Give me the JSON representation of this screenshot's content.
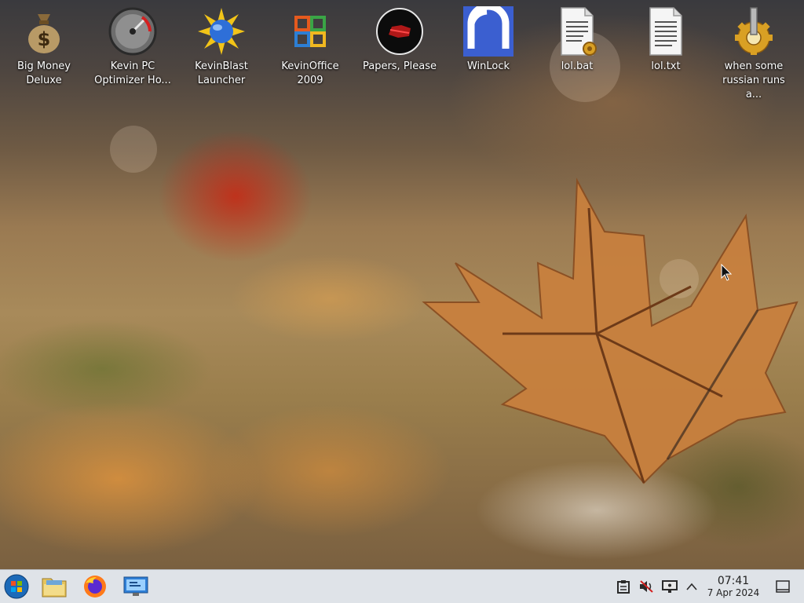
{
  "desktop": {
    "icons": [
      {
        "label_line1": "Big Money",
        "label_line2": "Deluxe",
        "icon": "money-bag-icon"
      },
      {
        "label_line1": "Kevin PC",
        "label_line2": "Optimizer Ho...",
        "icon": "speedometer-icon"
      },
      {
        "label_line1": "KevinBlast",
        "label_line2": "Launcher",
        "icon": "blast-sun-icon"
      },
      {
        "label_line1": "KevinOffice",
        "label_line2": "2009",
        "icon": "office-logo-icon"
      },
      {
        "label_line1": "Papers, Please",
        "label_line2": "",
        "icon": "stamp-seal-icon"
      },
      {
        "label_line1": "WinLock",
        "label_line2": "",
        "icon": "padlock-icon"
      },
      {
        "label_line1": "lol.bat",
        "label_line2": "",
        "icon": "batch-file-icon"
      },
      {
        "label_line1": "lol.txt",
        "label_line2": "",
        "icon": "text-file-icon"
      },
      {
        "label_line1": "when some",
        "label_line2": "russian runs a...",
        "icon": "gear-executable-icon"
      }
    ]
  },
  "taskbar": {
    "clock_time": "07:41",
    "clock_date": "7 Apr 2024"
  },
  "colors": {
    "taskbar_bg": "#dfe3e8",
    "accent_blue": "#3b5fd0"
  }
}
